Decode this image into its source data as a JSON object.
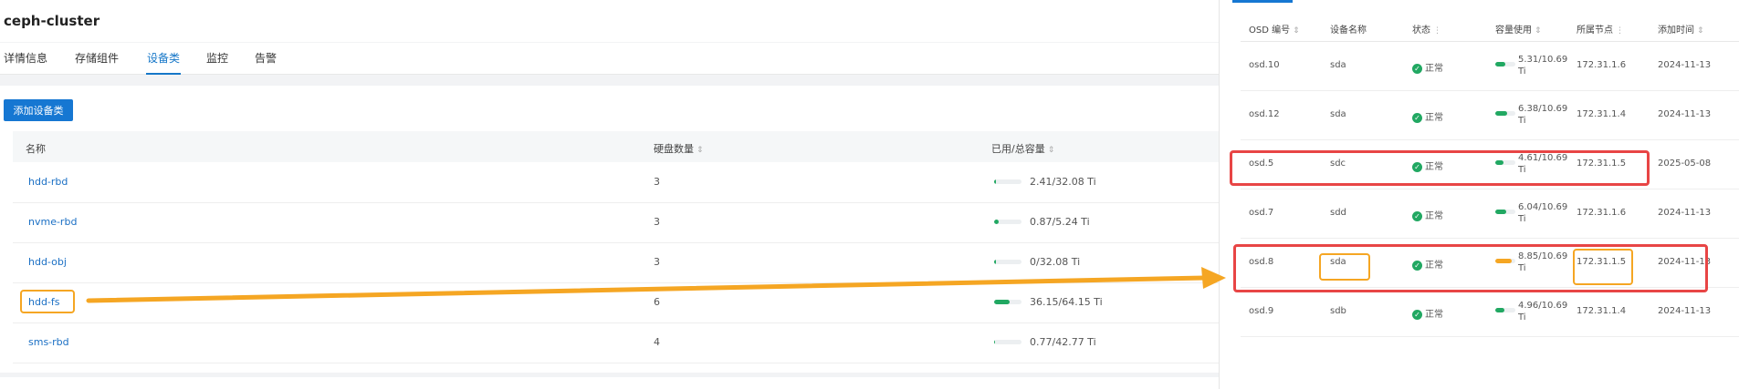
{
  "header": {
    "cluster_title": "ceph-cluster"
  },
  "tabs": [
    {
      "label": "详情信息",
      "active": false
    },
    {
      "label": "存储组件",
      "active": false
    },
    {
      "label": "设备类",
      "active": true
    },
    {
      "label": "监控",
      "active": false
    },
    {
      "label": "告警",
      "active": false
    }
  ],
  "toolbar": {
    "add_label": "添加设备类"
  },
  "device_table": {
    "columns": {
      "name": "名称",
      "disk_count": "硬盘数量",
      "usage": "已用/总容量"
    },
    "rows": [
      {
        "name": "hdd-rbd",
        "disk_count": "3",
        "usage": "2.41/32.08 Ti",
        "used_fraction": 0.075
      },
      {
        "name": "nvme-rbd",
        "disk_count": "3",
        "usage": "0.87/5.24 Ti",
        "used_fraction": 0.166
      },
      {
        "name": "hdd-obj",
        "disk_count": "3",
        "usage": "0/32.08 Ti",
        "used_fraction": 0.0
      },
      {
        "name": "hdd-fs",
        "disk_count": "6",
        "usage": "36.15/64.15 Ti",
        "used_fraction": 0.563
      },
      {
        "name": "sms-rbd",
        "disk_count": "4",
        "usage": "0.77/42.77 Ti",
        "used_fraction": 0.018
      }
    ]
  },
  "osd_table": {
    "columns": {
      "osd": "OSD 编号",
      "device": "设备名称",
      "status": "状态",
      "usage": "容量使用",
      "node": "所属节点",
      "added": "添加时间"
    },
    "rows": [
      {
        "osd": "osd.10",
        "device": "sda",
        "status": "正常",
        "usage": "5.31/10.69 Ti",
        "used_fraction": 0.497,
        "node": "172.31.1.6",
        "added": "2024-11-13"
      },
      {
        "osd": "osd.12",
        "device": "sda",
        "status": "正常",
        "usage": "6.38/10.69 Ti",
        "used_fraction": 0.597,
        "node": "172.31.1.4",
        "added": "2024-11-13"
      },
      {
        "osd": "osd.5",
        "device": "sdc",
        "status": "正常",
        "usage": "4.61/10.69 Ti",
        "used_fraction": 0.431,
        "node": "172.31.1.5",
        "added": "2025-05-08"
      },
      {
        "osd": "osd.7",
        "device": "sdd",
        "status": "正常",
        "usage": "6.04/10.69 Ti",
        "used_fraction": 0.565,
        "node": "172.31.1.6",
        "added": "2024-11-13"
      },
      {
        "osd": "osd.8",
        "device": "sda",
        "status": "正常",
        "usage": "8.85/10.69 Ti",
        "used_fraction": 0.828,
        "node": "172.31.1.5",
        "added": "2024-11-13"
      },
      {
        "osd": "osd.9",
        "device": "sdb",
        "status": "正常",
        "usage": "4.96/10.69 Ti",
        "used_fraction": 0.464,
        "node": "172.31.1.4",
        "added": "2024-11-13"
      }
    ]
  },
  "colors": {
    "accent": "#1677d2",
    "usage_ok": "#21a862",
    "usage_warn": "#f5a623",
    "highlight_red": "#e84545",
    "highlight_orange": "#f5a623"
  }
}
